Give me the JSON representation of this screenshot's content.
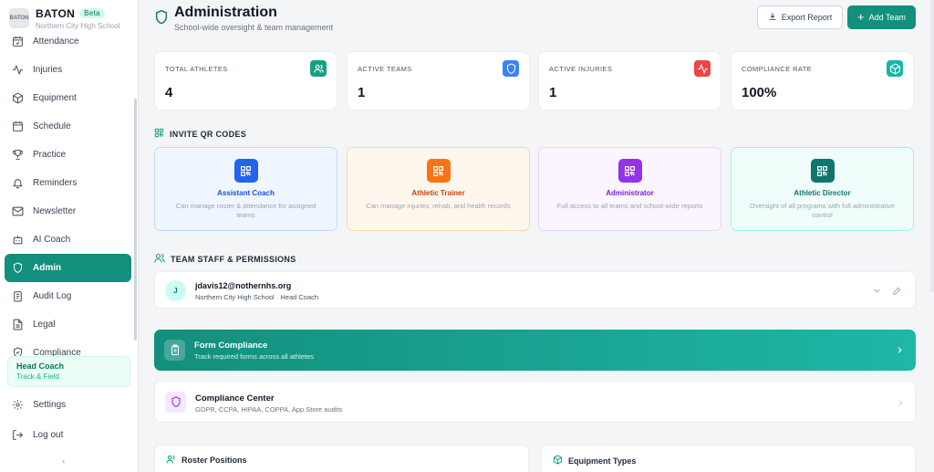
{
  "brand": {
    "name": "BATON",
    "badge": "Beta",
    "school": "Northern City High School",
    "logo_text": "BATON"
  },
  "nav": {
    "items": [
      {
        "label": "Attendance",
        "icon": "calendar-check-icon"
      },
      {
        "label": "Injuries",
        "icon": "activity-icon"
      },
      {
        "label": "Equipment",
        "icon": "box-icon"
      },
      {
        "label": "Schedule",
        "icon": "calendar-icon"
      },
      {
        "label": "Practice",
        "icon": "trophy-icon"
      },
      {
        "label": "Reminders",
        "icon": "bell-icon"
      },
      {
        "label": "Newsletter",
        "icon": "mail-icon"
      },
      {
        "label": "AI Coach",
        "icon": "bot-icon"
      },
      {
        "label": "Admin",
        "icon": "shield-icon",
        "active": true
      },
      {
        "label": "Audit Log",
        "icon": "clipboard-list-icon"
      },
      {
        "label": "Legal",
        "icon": "file-text-icon"
      },
      {
        "label": "Compliance",
        "icon": "shield-check-icon"
      }
    ]
  },
  "role": {
    "title": "Head Coach",
    "subtitle": "Track & Field"
  },
  "bottom_nav": {
    "settings": "Settings",
    "logout": "Log out"
  },
  "header": {
    "title": "Administration",
    "subtitle": "School-wide oversight & team management",
    "export_label": "Export Report",
    "add_label": "Add Team"
  },
  "stats": [
    {
      "label": "TOTAL ATHLETES",
      "value": "4",
      "color": "#14a085",
      "icon": "users-icon"
    },
    {
      "label": "ACTIVE TEAMS",
      "value": "1",
      "color": "#3b82f6",
      "icon": "shield-icon"
    },
    {
      "label": "ACTIVE INJURIES",
      "value": "1",
      "color": "#ef4444",
      "icon": "activity-icon"
    },
    {
      "label": "COMPLIANCE RATE",
      "value": "100%",
      "color": "#14b8a6",
      "icon": "box-icon"
    }
  ],
  "qr_section": {
    "title": "INVITE QR CODES"
  },
  "qr_cards": [
    {
      "title": "Assistant Coach",
      "desc": "Can manage roster & attendance for assigned teams",
      "accent": "#2563eb",
      "bg": "#eff6ff",
      "border": "#bfdbfe",
      "title_color": "#1d4ed8"
    },
    {
      "title": "Athletic Trainer",
      "desc": "Can manage injuries, rehab, and health records",
      "accent": "#f97316",
      "bg": "#fff7ed",
      "border": "#fed7aa",
      "title_color": "#c2410c"
    },
    {
      "title": "Administrator",
      "desc": "Full access to all teams and school-wide reports",
      "accent": "#9333ea",
      "bg": "#faf5ff",
      "border": "#e9d5ff",
      "title_color": "#7e22ce"
    },
    {
      "title": "Athletic Director",
      "desc": "Oversight of all programs with full administrative control",
      "accent": "#0f766e",
      "bg": "#f0fdfa",
      "border": "#99f6e4",
      "title_color": "#0f766e"
    }
  ],
  "staff_section": {
    "title": "TEAM STAFF & PERMISSIONS"
  },
  "staff": {
    "initial": "J",
    "email": "jdavis12@nothernhs.org",
    "detail": "Northern City High School · Head Coach"
  },
  "form_compliance": {
    "title": "Form Compliance",
    "subtitle": "Track required forms across all athletes"
  },
  "compliance_center": {
    "title": "Compliance Center",
    "subtitle": "GDPR, CCPA, HIPAA, COPPA, App Store audits"
  },
  "roster_positions": {
    "title": "Roster Positions"
  },
  "equipment_types": {
    "title": "Equipment Types"
  }
}
